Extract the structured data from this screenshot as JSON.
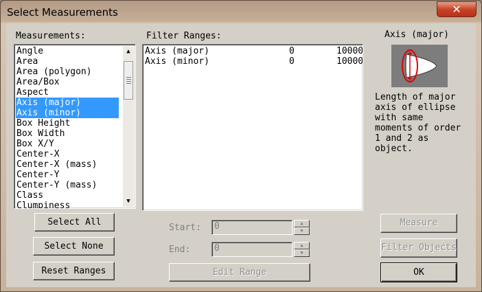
{
  "window": {
    "title": "Select Measurements",
    "close_glyph": "✕"
  },
  "measurements": {
    "label": "Measurements:",
    "items": [
      {
        "label": "Angle",
        "selected": false
      },
      {
        "label": "Area",
        "selected": false
      },
      {
        "label": "Area (polygon)",
        "selected": false
      },
      {
        "label": "Area/Box",
        "selected": false
      },
      {
        "label": "Aspect",
        "selected": false
      },
      {
        "label": "Axis (major)",
        "selected": true
      },
      {
        "label": "Axis (minor)",
        "selected": true
      },
      {
        "label": "Box Height",
        "selected": false
      },
      {
        "label": "Box Width",
        "selected": false
      },
      {
        "label": "Box X/Y",
        "selected": false
      },
      {
        "label": "Center-X",
        "selected": false
      },
      {
        "label": "Center-X (mass)",
        "selected": false
      },
      {
        "label": "Center-Y",
        "selected": false
      },
      {
        "label": "Center-Y (mass)",
        "selected": false
      },
      {
        "label": "Class",
        "selected": false
      },
      {
        "label": "Clumpiness",
        "selected": false
      }
    ],
    "scroll_up_glyph": "▲",
    "scroll_down_glyph": "▼"
  },
  "filter_ranges": {
    "label": "Filter Ranges:",
    "rows": [
      {
        "name": "Axis (major)",
        "min": "0",
        "max": "10000"
      },
      {
        "name": "Axis (minor)",
        "min": "0",
        "max": "10000"
      }
    ]
  },
  "buttons": {
    "select_all": "Select All",
    "select_none": "Select None",
    "reset_ranges": "Reset Ranges",
    "edit_range": "Edit Range",
    "measure": "Measure",
    "filter_objects": "Filter Objects",
    "ok": "OK"
  },
  "range_editor": {
    "start_label": "Start:",
    "start_value": "0",
    "end_label": "End:",
    "end_value": "0",
    "spin_up_glyph": "▲",
    "spin_down_glyph": "▼"
  },
  "info": {
    "title": "Axis (major)",
    "description": "Length of major\naxis of ellipse\nwith same\nmoments of order\n1 and 2 as\nobject.",
    "preview_icon": "ellipse-major-axis-icon",
    "accent_color": "#e00000"
  },
  "colors": {
    "selection": "#3399ff",
    "close_button": "#c8442a"
  }
}
